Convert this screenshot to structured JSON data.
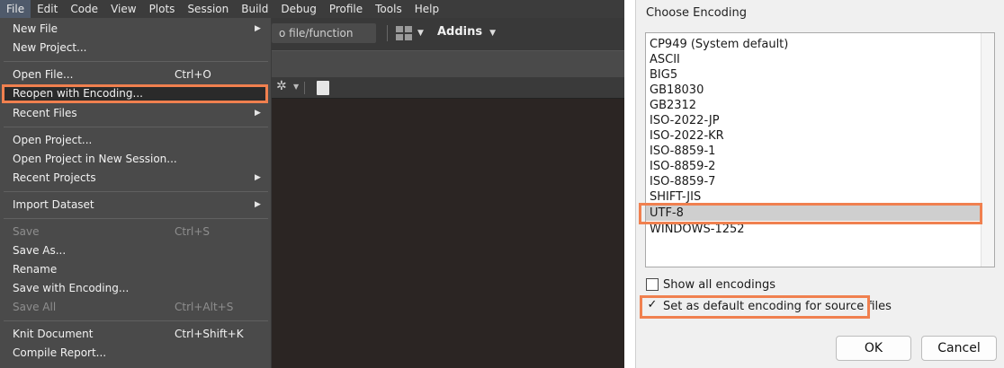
{
  "menubar": {
    "items": [
      "File",
      "Edit",
      "Code",
      "View",
      "Plots",
      "Session",
      "Build",
      "Debug",
      "Profile",
      "Tools",
      "Help"
    ]
  },
  "toolbar": {
    "goto_placeholder": "o file/function",
    "addins_label": "Addins"
  },
  "file_menu": {
    "items": [
      {
        "label": "New File",
        "shortcut": "",
        "submenu": true,
        "disabled": false
      },
      {
        "label": "New Project...",
        "shortcut": "",
        "submenu": false,
        "disabled": false
      },
      {
        "label": "Open File...",
        "shortcut": "Ctrl+O",
        "submenu": false,
        "disabled": false
      },
      {
        "label": "Reopen with Encoding...",
        "shortcut": "",
        "submenu": false,
        "disabled": false,
        "highlighted": true
      },
      {
        "label": "Recent Files",
        "shortcut": "",
        "submenu": true,
        "disabled": false
      },
      {
        "label": "Open Project...",
        "shortcut": "",
        "submenu": false,
        "disabled": false
      },
      {
        "label": "Open Project in New Session...",
        "shortcut": "",
        "submenu": false,
        "disabled": false
      },
      {
        "label": "Recent Projects",
        "shortcut": "",
        "submenu": true,
        "disabled": false
      },
      {
        "label": "Import Dataset",
        "shortcut": "",
        "submenu": true,
        "disabled": false
      },
      {
        "label": "Save",
        "shortcut": "Ctrl+S",
        "submenu": false,
        "disabled": true
      },
      {
        "label": "Save As...",
        "shortcut": "",
        "submenu": false,
        "disabled": false
      },
      {
        "label": "Rename",
        "shortcut": "",
        "submenu": false,
        "disabled": false
      },
      {
        "label": "Save with Encoding...",
        "shortcut": "",
        "submenu": false,
        "disabled": false
      },
      {
        "label": "Save All",
        "shortcut": "Ctrl+Alt+S",
        "submenu": false,
        "disabled": true
      },
      {
        "label": "Knit Document",
        "shortcut": "Ctrl+Shift+K",
        "submenu": false,
        "disabled": false
      },
      {
        "label": "Compile Report...",
        "shortcut": "",
        "submenu": false,
        "disabled": false
      }
    ]
  },
  "dialog": {
    "title": "Choose Encoding",
    "encodings": [
      "CP949 (System default)",
      "ASCII",
      "BIG5",
      "GB18030",
      "GB2312",
      "ISO-2022-JP",
      "ISO-2022-KR",
      "ISO-8859-1",
      "ISO-8859-2",
      "ISO-8859-7",
      "SHIFT-JIS",
      "UTF-8",
      "WINDOWS-1252"
    ],
    "selected": "UTF-8",
    "show_all_label": "Show all encodings",
    "show_all_checked": false,
    "set_default_label": "Set as default encoding for source files",
    "set_default_checked": true,
    "checkmark": "✓",
    "ok_label": "OK",
    "cancel_label": "Cancel"
  },
  "colors": {
    "highlight_border": "#f0804f",
    "menu_bg": "#4a4a4a",
    "editor_bg": "#2b2523"
  }
}
